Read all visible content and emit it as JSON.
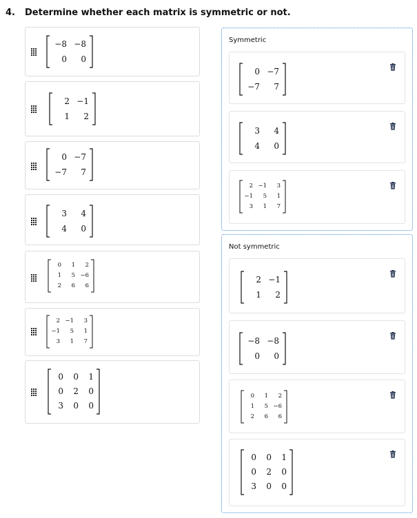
{
  "question": {
    "number": "4.",
    "text": "Determine whether each matrix is symmetric or not."
  },
  "source_items": [
    {
      "name": "matrix-neg8-neg8-0-0",
      "rows": [
        [
          "−8",
          "−8"
        ],
        [
          "0",
          "0"
        ]
      ]
    },
    {
      "name": "matrix-2-neg1-1-2",
      "rows": [
        [
          "2",
          "−1"
        ],
        [
          "1",
          "2"
        ]
      ]
    },
    {
      "name": "matrix-0-neg7-neg7-7",
      "rows": [
        [
          "0",
          "−7"
        ],
        [
          "−7",
          "7"
        ]
      ]
    },
    {
      "name": "matrix-3-4-4-0",
      "rows": [
        [
          "3",
          "4"
        ],
        [
          "4",
          "0"
        ]
      ]
    },
    {
      "name": "matrix-3x3-0-1-2",
      "rows": [
        [
          "0",
          "1",
          "2"
        ],
        [
          "1",
          "5",
          "−6"
        ],
        [
          "2",
          "6",
          "6"
        ]
      ]
    },
    {
      "name": "matrix-3x3-2-neg1-3",
      "rows": [
        [
          "2",
          "−1",
          "3"
        ],
        [
          "−1",
          "5",
          "1"
        ],
        [
          "3",
          "1",
          "7"
        ]
      ]
    },
    {
      "name": "matrix-3x3-0-0-1",
      "rows": [
        [
          "0",
          "0",
          "1"
        ],
        [
          "0",
          "2",
          "0"
        ],
        [
          "3",
          "0",
          "0"
        ]
      ]
    }
  ],
  "symmetric": {
    "title": "Symmetric",
    "items": [
      {
        "name": "matrix-0-neg7-neg7-7",
        "rows": [
          [
            "0",
            "−7"
          ],
          [
            "−7",
            "7"
          ]
        ]
      },
      {
        "name": "matrix-3-4-4-0",
        "rows": [
          [
            "3",
            "4"
          ],
          [
            "4",
            "0"
          ]
        ]
      },
      {
        "name": "matrix-3x3-2-neg1-3",
        "rows": [
          [
            "2",
            "−1",
            "3"
          ],
          [
            "−1",
            "5",
            "1"
          ],
          [
            "3",
            "1",
            "7"
          ]
        ]
      }
    ]
  },
  "not_symmetric": {
    "title": "Not symmetric",
    "items": [
      {
        "name": "matrix-2-neg1-1-2",
        "rows": [
          [
            "2",
            "−1"
          ],
          [
            "1",
            "2"
          ]
        ]
      },
      {
        "name": "matrix-neg8-neg8-0-0",
        "rows": [
          [
            "−8",
            "−8"
          ],
          [
            "0",
            "0"
          ]
        ]
      },
      {
        "name": "matrix-3x3-0-1-2",
        "rows": [
          [
            "0",
            "1",
            "2"
          ],
          [
            "1",
            "5",
            "−6"
          ],
          [
            "2",
            "6",
            "6"
          ]
        ]
      },
      {
        "name": "matrix-3x3-0-0-1",
        "rows": [
          [
            "0",
            "0",
            "1"
          ],
          [
            "0",
            "2",
            "0"
          ],
          [
            "3",
            "0",
            "0"
          ]
        ]
      }
    ]
  }
}
